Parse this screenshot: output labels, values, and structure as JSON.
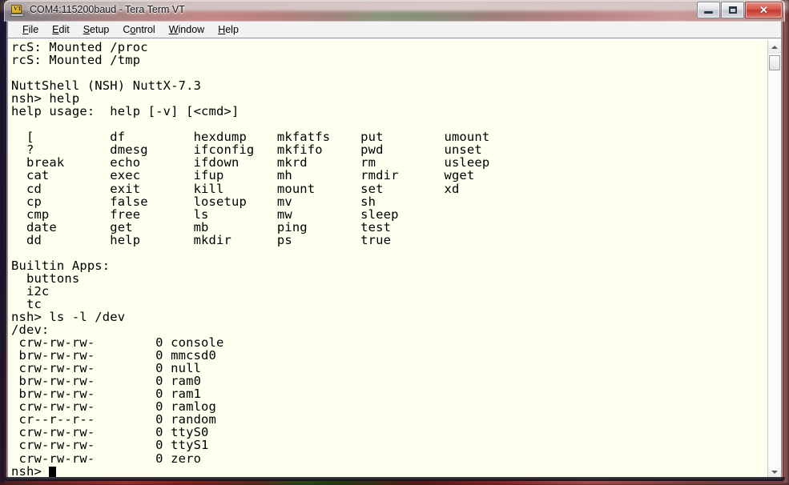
{
  "window": {
    "title": "COM4:115200baud - Tera Term VT",
    "app_icon": "tera-term-vt-icon",
    "icon_label": "VT",
    "controls": {
      "minimize": "Minimize",
      "maximize": "Maximize",
      "close": "✕",
      "close_label": "Close"
    }
  },
  "menubar": {
    "items": [
      {
        "accel": "F",
        "rest": "ile"
      },
      {
        "accel": "E",
        "rest": "dit"
      },
      {
        "accel": "S",
        "rest": "etup"
      },
      {
        "pre": "C",
        "accel": "o",
        "rest": "ntrol"
      },
      {
        "accel": "W",
        "rest": "indow"
      },
      {
        "accel": "H",
        "rest": "elp"
      }
    ]
  },
  "terminal": {
    "background_color": "#fffff0",
    "foreground_color": "#000000",
    "cursor": "block",
    "lines": [
      "rcS: Mounted /proc",
      "rcS: Mounted /tmp",
      "",
      "NuttShell (NSH) NuttX-7.3",
      "nsh> help",
      "help usage:  help [-v] [<cmd>]",
      "",
      "  [          df         hexdump    mkfatfs    put        umount",
      "  ?          dmesg      ifconfig   mkfifo     pwd        unset",
      "  break      echo       ifdown     mkrd       rm         usleep",
      "  cat        exec       ifup       mh         rmdir      wget",
      "  cd         exit       kill       mount      set        xd",
      "  cp         false      losetup    mv         sh",
      "  cmp        free       ls         mw         sleep",
      "  date       get        mb         ping       test",
      "  dd         help       mkdir      ps         true",
      "",
      "Builtin Apps:",
      "  buttons",
      "  i2c",
      "  tc",
      "nsh> ls -l /dev",
      "/dev:",
      " crw-rw-rw-        0 console",
      " brw-rw-rw-        0 mmcsd0",
      " crw-rw-rw-        0 null",
      " brw-rw-rw-        0 ram0",
      " brw-rw-rw-        0 ram1",
      " crw-rw-rw-        0 ramlog",
      " cr--r--r--        0 random",
      " crw-rw-rw-        0 ttyS0",
      " crw-rw-rw-        0 ttyS1",
      " crw-rw-rw-        0 zero"
    ],
    "prompt_line": "nsh> ",
    "commands_table": {
      "columns": 6,
      "rows": [
        [
          "[",
          "df",
          "hexdump",
          "mkfatfs",
          "put",
          "umount"
        ],
        [
          "?",
          "dmesg",
          "ifconfig",
          "mkfifo",
          "pwd",
          "unset"
        ],
        [
          "break",
          "echo",
          "ifdown",
          "mkrd",
          "rm",
          "usleep"
        ],
        [
          "cat",
          "exec",
          "ifup",
          "mh",
          "rmdir",
          "wget"
        ],
        [
          "cd",
          "exit",
          "kill",
          "mount",
          "set",
          "xd"
        ],
        [
          "cp",
          "false",
          "losetup",
          "mv",
          "sh",
          ""
        ],
        [
          "cmp",
          "free",
          "ls",
          "mw",
          "sleep",
          ""
        ],
        [
          "date",
          "get",
          "mb",
          "ping",
          "test",
          ""
        ],
        [
          "dd",
          "help",
          "mkdir",
          "ps",
          "true",
          ""
        ]
      ]
    },
    "builtin_apps": [
      "buttons",
      "i2c",
      "tc"
    ],
    "dev_listing": {
      "path": "/dev:",
      "entries": [
        {
          "perms": "crw-rw-rw-",
          "size": "0",
          "name": "console"
        },
        {
          "perms": "brw-rw-rw-",
          "size": "0",
          "name": "mmcsd0"
        },
        {
          "perms": "crw-rw-rw-",
          "size": "0",
          "name": "null"
        },
        {
          "perms": "brw-rw-rw-",
          "size": "0",
          "name": "ram0"
        },
        {
          "perms": "brw-rw-rw-",
          "size": "0",
          "name": "ram1"
        },
        {
          "perms": "crw-rw-rw-",
          "size": "0",
          "name": "ramlog"
        },
        {
          "perms": "cr--r--r--",
          "size": "0",
          "name": "random"
        },
        {
          "perms": "crw-rw-rw-",
          "size": "0",
          "name": "ttyS0"
        },
        {
          "perms": "crw-rw-rw-",
          "size": "0",
          "name": "ttyS1"
        },
        {
          "perms": "crw-rw-rw-",
          "size": "0",
          "name": "zero"
        }
      ]
    }
  },
  "scrollbar": {
    "up_arrow": "scroll-up-icon",
    "down_arrow": "scroll-down-icon",
    "thumb": "scrollbar-thumb"
  }
}
